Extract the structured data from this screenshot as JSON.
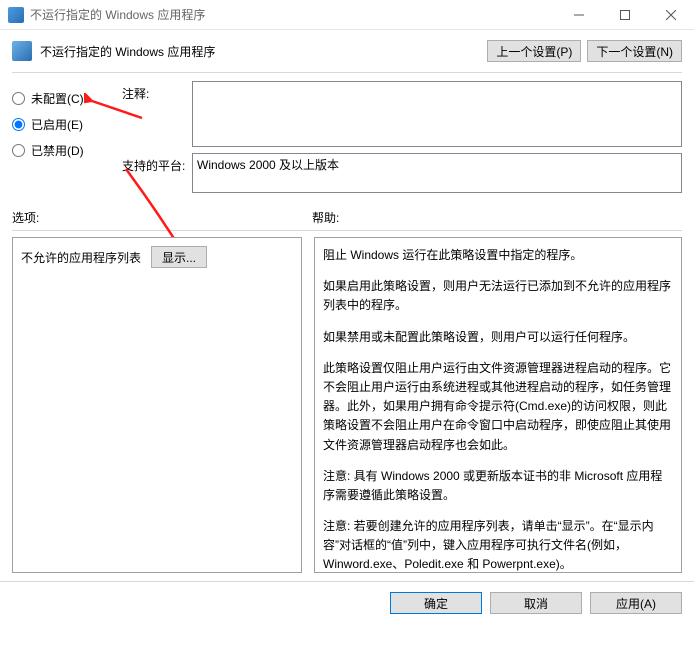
{
  "window": {
    "title": "不运行指定的 Windows 应用程序"
  },
  "header": {
    "title": "不运行指定的 Windows 应用程序",
    "prev_setting": "上一个设置(P)",
    "next_setting": "下一个设置(N)"
  },
  "radios": {
    "not_configured": "未配置(C)",
    "enabled": "已启用(E)",
    "disabled": "已禁用(D)",
    "selected": "enabled"
  },
  "fields": {
    "comment_label": "注释:",
    "comment_value": "",
    "platform_label": "支持的平台:",
    "platform_value": "Windows 2000 及以上版本"
  },
  "section_labels": {
    "options": "选项:",
    "help": "帮助:"
  },
  "options_panel": {
    "list_label": "不允许的应用程序列表",
    "show_button": "显示..."
  },
  "help_panel": {
    "p1": "阻止 Windows 运行在此策略设置中指定的程序。",
    "p2": "如果启用此策略设置，则用户无法运行已添加到不允许的应用程序列表中的程序。",
    "p3": "如果禁用或未配置此策略设置，则用户可以运行任何程序。",
    "p4": "此策略设置仅阻止用户运行由文件资源管理器进程启动的程序。它不会阻止用户运行由系统进程或其他进程启动的程序，如任务管理器。此外，如果用户拥有命令提示符(Cmd.exe)的访问权限，则此策略设置不会阻止用户在命令窗口中启动程序，即使应阻止其使用文件资源管理器启动程序也会如此。",
    "p5": "注意: 具有 Windows 2000 或更新版本证书的非 Microsoft 应用程序需要遵循此策略设置。",
    "p6": "注意: 若要创建允许的应用程序列表，请单击“显示”。在“显示内容”对话框的“值”列中，键入应用程序可执行文件名(例如，Winword.exe、Poledit.exe 和 Powerpnt.exe)。"
  },
  "footer": {
    "ok": "确定",
    "cancel": "取消",
    "apply": "应用(A)"
  }
}
